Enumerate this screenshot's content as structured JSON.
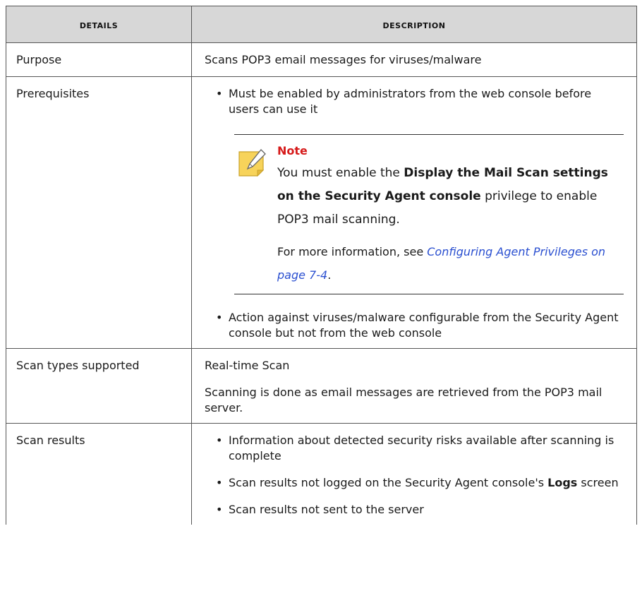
{
  "table": {
    "header": {
      "details": "Details",
      "description": "Description"
    },
    "rows": {
      "purpose": {
        "label": "Purpose",
        "text": "Scans POP3 email messages for viruses/malware"
      },
      "prerequisites": {
        "label": "Prerequisites",
        "bullet1": "Must be enabled by administrators from the web console before users can use it",
        "note": {
          "icon": "note-pencil-icon",
          "title": "Note",
          "text_before": "You must enable the ",
          "text_bold": "Display the Mail Scan settings on the Security Agent console",
          "text_after": " privilege to enable POP3 mail scanning.",
          "more_before": "For more information, see ",
          "more_link": "Configuring Agent Privileges on page 7-4",
          "more_after": "."
        },
        "bullet2": "Action against viruses/malware configurable from the Security Agent console but not from the web console"
      },
      "scan_types": {
        "label": "Scan types supported",
        "line1": "Real-time Scan",
        "line2": "Scanning is done as email messages are retrieved from the POP3 mail server."
      },
      "scan_results": {
        "label": "Scan results",
        "bullet1": "Information about detected security risks available after scanning is complete",
        "bullet2_before": "Scan results not logged on the Security Agent console's ",
        "bullet2_bold": "Logs",
        "bullet2_after": " screen",
        "bullet3": "Scan results not sent to the server"
      }
    }
  },
  "colors": {
    "header_bg": "#d7d7d7",
    "note_title": "#d61a1a",
    "link": "#2a4fd0",
    "note_icon_fill": "#f7d35a"
  }
}
